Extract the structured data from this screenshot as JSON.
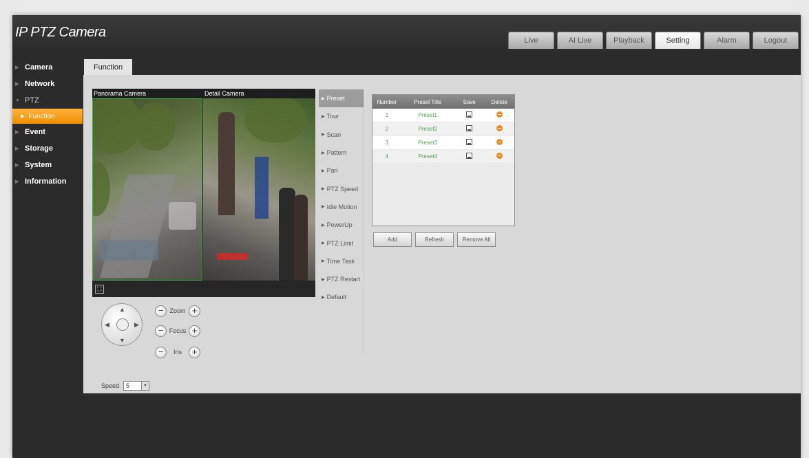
{
  "app": {
    "title": "IP PTZ Camera"
  },
  "nav_tabs": [
    {
      "label": "Live",
      "active": false
    },
    {
      "label": "AI Live",
      "active": false
    },
    {
      "label": "Playback",
      "active": false
    },
    {
      "label": "Setting",
      "active": true
    },
    {
      "label": "Alarm",
      "active": false
    },
    {
      "label": "Logout",
      "active": false
    }
  ],
  "sidebar": {
    "items": [
      {
        "label": "Camera"
      },
      {
        "label": "Network"
      },
      {
        "label": "PTZ",
        "expanded": true,
        "sub": "Function"
      },
      {
        "label": "Event"
      },
      {
        "label": "Storage"
      },
      {
        "label": "System"
      },
      {
        "label": "Information"
      }
    ]
  },
  "page_tab": "Function",
  "video": {
    "panorama_label": "Panorama Camera",
    "detail_label": "Detail Camera"
  },
  "ptz": {
    "zoom_label": "Zoom",
    "focus_label": "Focus",
    "iris_label": "Iris",
    "minus": "−",
    "plus": "+",
    "speed_label": "Speed",
    "speed_value": "5",
    "arrow_up": "▲",
    "arrow_down": "▼",
    "arrow_left": "◀",
    "arrow_right": "▶"
  },
  "func_menu": [
    {
      "label": "Preset",
      "active": true
    },
    {
      "label": "Tour"
    },
    {
      "label": "Scan"
    },
    {
      "label": "Pattern"
    },
    {
      "label": "Pan"
    },
    {
      "label": "PTZ Speed"
    },
    {
      "label": "Idle Motion"
    },
    {
      "label": "PowerUp"
    },
    {
      "label": "PTZ Limit"
    },
    {
      "label": "Time Task"
    },
    {
      "label": "PTZ Restart"
    },
    {
      "label": "Default"
    }
  ],
  "preset_table": {
    "headers": [
      "Number",
      "Preset Title",
      "Save",
      "Delete"
    ],
    "rows": [
      {
        "number": "1",
        "title": "Preset1"
      },
      {
        "number": "2",
        "title": "Preset2"
      },
      {
        "number": "3",
        "title": "Preset3"
      },
      {
        "number": "4",
        "title": "Preset4"
      }
    ]
  },
  "actions": {
    "add": "Add",
    "refresh": "Refresh",
    "remove_all": "Remove All"
  },
  "colors": {
    "accent": "#f39a14",
    "preset_text": "#4ea34e",
    "delete_icon": "#f08a1c"
  }
}
